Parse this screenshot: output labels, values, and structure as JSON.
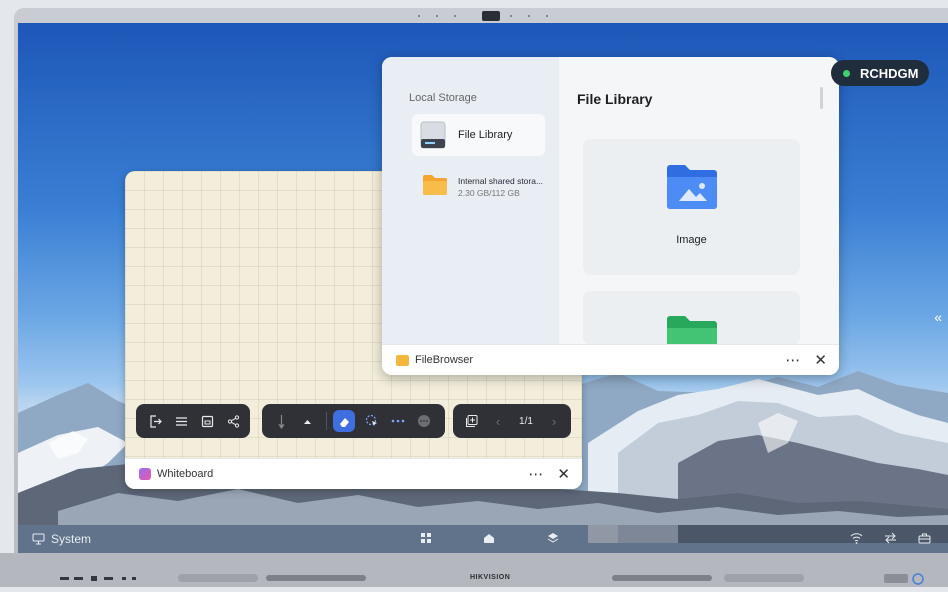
{
  "device": {
    "brand": "HIKVISION"
  },
  "badge": {
    "label": "RCHDGM",
    "status_color": "#3fd26b"
  },
  "file_browser": {
    "app_name": "FileBrowser",
    "sidebar": {
      "section_label": "Local Storage",
      "items": [
        {
          "label": "File Library",
          "icon": "drive-icon",
          "selected": true
        },
        {
          "label": "Internal shared stora...",
          "sub": "2.30 GB/112 GB",
          "icon": "folder-icon"
        }
      ]
    },
    "main": {
      "title": "File Library",
      "cards": [
        {
          "label": "Image",
          "icon": "image-folder-icon"
        },
        {
          "label": "",
          "icon": "green-folder-icon"
        }
      ]
    }
  },
  "whiteboard": {
    "app_name": "Whiteboard",
    "page_indicator": "1/1",
    "toolbar_left": [
      "exit-icon",
      "menu-icon",
      "save-icon",
      "share-icon"
    ],
    "toolbar_mid": [
      "pen-icon",
      "caret-up-icon",
      "eraser-icon",
      "select-icon",
      "more-dots-icon",
      "more-circle-icon"
    ],
    "toolbar_right": [
      "add-page-icon",
      "prev-page-icon",
      "next-page-icon"
    ]
  },
  "taskbar": {
    "system_label": "System",
    "icons": [
      "windows-grid-icon",
      "home-icon",
      "layers-icon",
      "wifi-icon",
      "transfer-icon",
      "toolbox-icon"
    ]
  },
  "window_controls": {
    "more": "⋯",
    "close": "✕"
  },
  "colors": {
    "accent": "#3d6fe0",
    "toolbar": "#2f3136",
    "whiteboard_bg": "#f3eedb"
  }
}
